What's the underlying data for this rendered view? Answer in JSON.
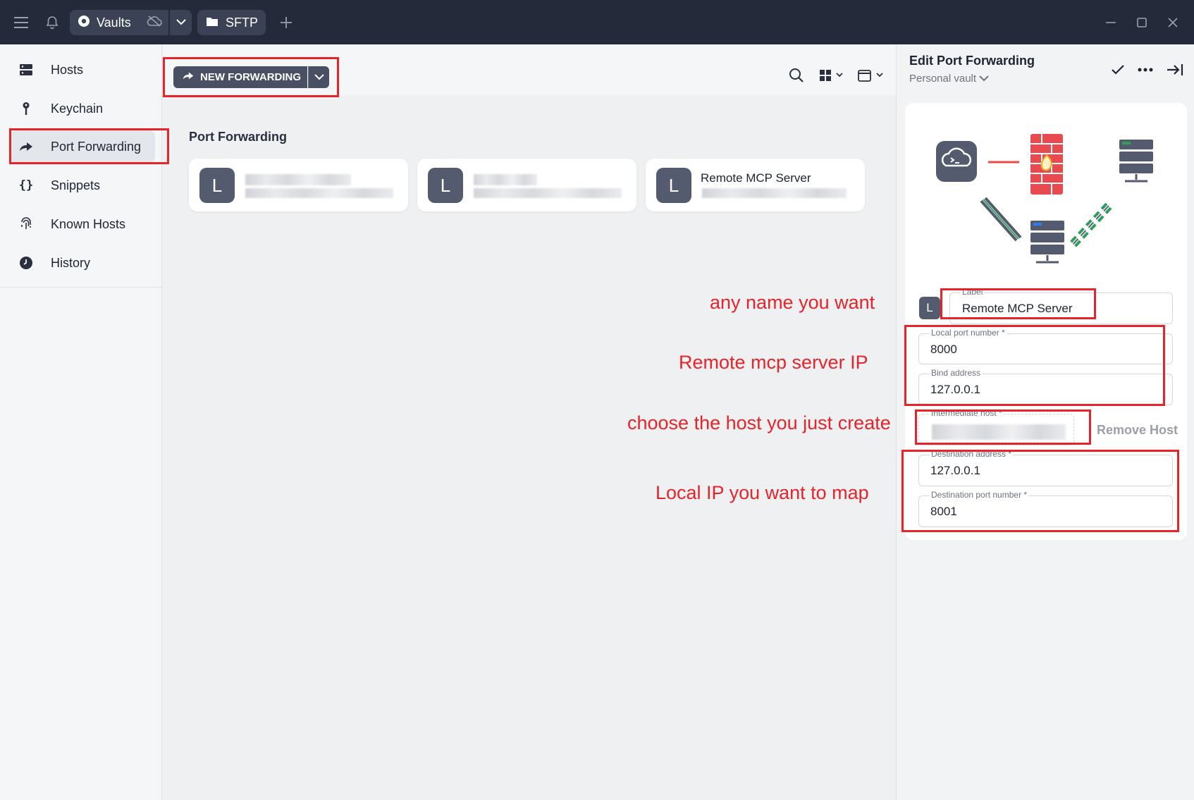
{
  "titlebar": {
    "vaults_label": "Vaults",
    "sftp_label": "SFTP",
    "icons": [
      "menu-icon",
      "bell-icon",
      "vault-icon",
      "cloud-off-icon",
      "chevron-down-icon",
      "folder-icon",
      "plus-icon",
      "minimize-icon",
      "maximize-icon",
      "close-icon"
    ]
  },
  "sidebar": {
    "items": [
      {
        "label": "Hosts",
        "icon": "hosts-icon"
      },
      {
        "label": "Keychain",
        "icon": "key-icon"
      },
      {
        "label": "Port Forwarding",
        "icon": "forward-arrow-icon",
        "active": true
      },
      {
        "label": "Snippets",
        "icon": "braces-icon"
      },
      {
        "label": "Known Hosts",
        "icon": "fingerprint-icon"
      },
      {
        "label": "History",
        "icon": "clock-icon"
      }
    ]
  },
  "toolbar": {
    "new_forwarding_label": "NEW FORWARDING"
  },
  "main": {
    "section_title": "Port Forwarding",
    "cards": [
      {
        "avatar": "L",
        "title": ""
      },
      {
        "avatar": "L",
        "title": ""
      },
      {
        "avatar": "L",
        "title": "Remote MCP Server"
      }
    ]
  },
  "panel": {
    "title": "Edit Port Forwarding",
    "vault": "Personal vault",
    "avatar_letter": "L",
    "fields": {
      "label": {
        "label": "Label",
        "value": "Remote MCP Server"
      },
      "local_port": {
        "label": "Local port number *",
        "value": "8000"
      },
      "bind_address": {
        "label": "Bind address",
        "value": "127.0.0.1"
      },
      "intermediate_host": {
        "label": "Intermediate host *",
        "value": ""
      },
      "destination_address": {
        "label": "Destination address *",
        "value": "127.0.0.1"
      },
      "destination_port": {
        "label": "Destination port number *",
        "value": "8001"
      }
    },
    "remove_host_label": "Remove Host"
  },
  "annotations": {
    "label_note": "any name you want",
    "remote_note": "Remote mcp server IP",
    "host_note": "choose the host you just create",
    "local_note": "Local IP you want to map"
  },
  "colors": {
    "titlebar_bg": "#252a3b",
    "annotation_red": "#e8232a",
    "firewall_red": "#e84a4f",
    "tunnel_green": "#2e9e5b"
  }
}
